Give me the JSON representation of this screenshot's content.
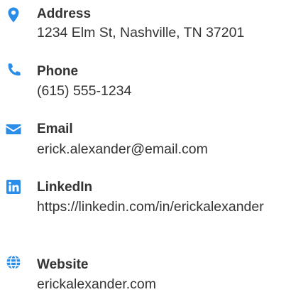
{
  "accent_color": "#2a8de8",
  "contact": {
    "items": [
      {
        "icon": "map-marker-icon",
        "label": "Address",
        "value": "1234 Elm St, Nashville, TN 37201"
      },
      {
        "icon": "phone-icon",
        "label": "Phone",
        "value": "(615) 555-1234"
      },
      {
        "icon": "envelope-icon",
        "label": "Email",
        "value": "erick.alexander@email.com"
      },
      {
        "icon": "linkedin-icon",
        "label": "LinkedIn",
        "value": "https://linkedin.com/in/erickalexander"
      },
      {
        "icon": "globe-icon",
        "label": "Website",
        "value": "erickalexander.com"
      }
    ]
  }
}
